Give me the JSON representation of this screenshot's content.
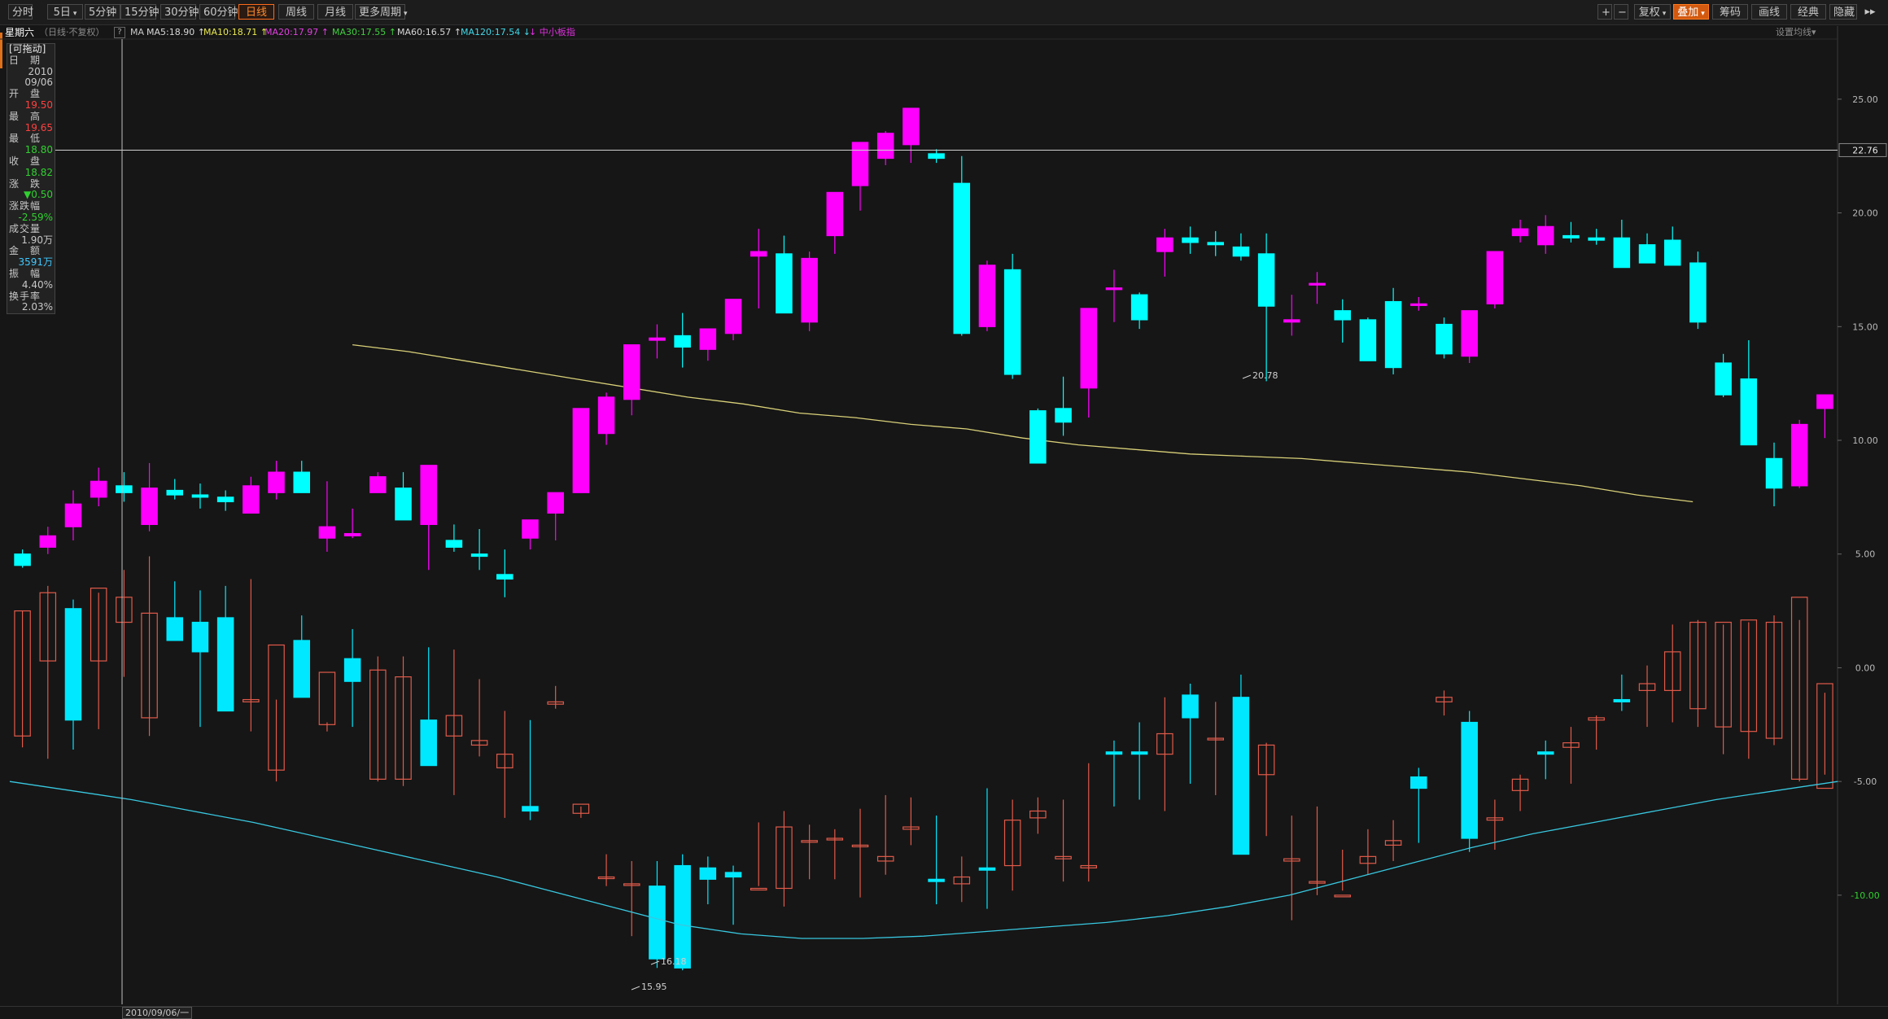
{
  "toolbar": {
    "left_buttons": [
      {
        "label": "分时",
        "active": false,
        "caret": false
      },
      {
        "label": "5日",
        "active": false,
        "caret": true
      },
      {
        "label": "5分钟",
        "active": false,
        "caret": false
      },
      {
        "label": "15分钟",
        "active": false,
        "caret": false
      },
      {
        "label": "30分钟",
        "active": false,
        "caret": false
      },
      {
        "label": "60分钟",
        "active": false,
        "caret": false
      },
      {
        "label": "日线",
        "active": true,
        "caret": false
      },
      {
        "label": "周线",
        "active": false,
        "caret": false
      },
      {
        "label": "月线",
        "active": false,
        "caret": false
      },
      {
        "label": "更多周期",
        "active": false,
        "caret": true
      }
    ],
    "zoom_in": "+",
    "zoom_out": "−",
    "right_buttons": [
      {
        "label": "复权",
        "caret": true,
        "hot": false
      },
      {
        "label": "叠加",
        "caret": true,
        "hot": true
      },
      {
        "label": "筹码",
        "caret": false,
        "hot": false
      },
      {
        "label": "画线",
        "caret": false,
        "hot": false
      },
      {
        "label": "经典",
        "caret": false,
        "hot": false
      },
      {
        "label": "隐藏",
        "caret": false,
        "hot": false
      }
    ],
    "hide_arrows": "▸▸"
  },
  "indicator_bar": {
    "title": "星期六",
    "subtitle": "（日线·不复权）",
    "help": "?",
    "ma_label": "MA",
    "items": [
      {
        "text": "MA5:18.90",
        "arrow": "↑",
        "color": "#d8d8d8"
      },
      {
        "text": "MA10:18.71",
        "arrow": "↑",
        "color": "#e8e850"
      },
      {
        "text": "MA20:17.97",
        "arrow": "↑",
        "color": "#e040e0"
      },
      {
        "text": "MA30:17.55",
        "arrow": "↑",
        "color": "#40d040"
      },
      {
        "text": "MA60:16.57",
        "arrow": "↑",
        "color": "#d8d8d8"
      },
      {
        "text": "MA120:17.54",
        "arrow": "↓",
        "color": "#40d8e8"
      },
      {
        "text": "中小板指",
        "arrow": "",
        "color": "#e030e0"
      }
    ],
    "settings": "设置均线",
    "settings_caret": "▾"
  },
  "info_panel": {
    "header": "[可拖动]",
    "rows": [
      {
        "label": "日　期",
        "values": [
          "2010",
          "09/06"
        ],
        "color": "#c8c8c8"
      },
      {
        "label": "开　盘",
        "values": [
          "19.50"
        ],
        "color": "#ff4040"
      },
      {
        "label": "最　高",
        "values": [
          "19.65"
        ],
        "color": "#ff4040"
      },
      {
        "label": "最　低",
        "values": [
          "18.80"
        ],
        "color": "#30d030"
      },
      {
        "label": "收　盘",
        "values": [
          "18.82"
        ],
        "color": "#30d030"
      },
      {
        "label": "涨　跌",
        "values": [
          "▼0.50"
        ],
        "color": "#30d030"
      },
      {
        "label": "涨跌幅",
        "values": [
          "-2.59%"
        ],
        "color": "#30d030"
      },
      {
        "label": "成交量",
        "values": [
          "1.90万"
        ],
        "color": "#c8c8c8"
      },
      {
        "label": "金　额",
        "values": [
          "3591万"
        ],
        "color": "#40c8ff"
      },
      {
        "label": "振　幅",
        "values": [
          "4.40%"
        ],
        "color": "#c8c8c8"
      },
      {
        "label": "换手率",
        "values": [
          "2.03%"
        ],
        "color": "#c8c8c8"
      }
    ]
  },
  "crosshair": {
    "price_tag": "22.76",
    "date_tag": "2010/09/06/一"
  },
  "annotations": {
    "high": "20.78",
    "low1": "16.18",
    "low2": "15.95"
  },
  "colors": {
    "up": "#ff00ff",
    "down": "#00ffff",
    "up_overlay": "#e05a4a",
    "down_overlay": "#00e8ff",
    "accent": "#ff6a1a"
  },
  "chart_data": {
    "type": "candlestick",
    "y_axis_ticks": [
      "25.00",
      "20.00",
      "15.00",
      "10.00",
      "5.00",
      "0.00",
      "-5.00",
      "-10.00"
    ],
    "y_tick_values": [
      25,
      20,
      15,
      10,
      5,
      0,
      -5,
      -10
    ],
    "ylim": [
      -14.8,
      27.5
    ],
    "main_series": {
      "name": "星期六",
      "candles": [
        [
          5.0,
          5.2,
          4.4,
          4.5
        ],
        [
          5.3,
          6.2,
          5.0,
          5.8
        ],
        [
          6.2,
          7.8,
          5.6,
          7.2
        ],
        [
          7.5,
          8.8,
          7.1,
          8.2
        ],
        [
          8.0,
          8.6,
          7.3,
          7.7
        ],
        [
          6.3,
          9.0,
          6.0,
          7.9
        ],
        [
          7.8,
          8.3,
          7.4,
          7.6
        ],
        [
          7.6,
          8.1,
          7.0,
          7.5
        ],
        [
          7.5,
          7.8,
          6.9,
          7.3
        ],
        [
          6.8,
          8.4,
          6.8,
          8.0
        ],
        [
          7.7,
          9.1,
          7.4,
          8.6
        ],
        [
          8.6,
          9.1,
          7.9,
          7.7
        ],
        [
          5.7,
          8.2,
          5.1,
          6.2
        ],
        [
          5.8,
          7.0,
          5.7,
          5.9
        ],
        [
          7.7,
          8.6,
          7.7,
          8.4
        ],
        [
          7.9,
          8.6,
          6.8,
          6.5
        ],
        [
          6.3,
          8.0,
          4.3,
          8.9
        ],
        [
          5.6,
          6.3,
          5.1,
          5.3
        ],
        [
          5.0,
          6.1,
          4.3,
          4.9
        ],
        [
          4.1,
          5.2,
          3.1,
          3.9
        ],
        [
          5.7,
          6.2,
          5.2,
          6.5
        ],
        [
          6.8,
          7.7,
          5.6,
          7.7
        ],
        [
          7.7,
          9.1,
          7.7,
          11.4
        ],
        [
          10.3,
          12.1,
          9.8,
          11.9
        ],
        [
          11.8,
          12.3,
          11.1,
          14.2
        ],
        [
          14.4,
          15.1,
          13.6,
          14.5
        ],
        [
          14.6,
          15.6,
          13.2,
          14.1
        ],
        [
          14.0,
          14.5,
          13.5,
          14.9
        ],
        [
          14.7,
          16.1,
          14.4,
          16.2
        ],
        [
          18.1,
          19.3,
          15.8,
          18.3
        ],
        [
          18.2,
          19.0,
          16.7,
          15.6
        ],
        [
          15.2,
          18.3,
          14.8,
          18.0
        ],
        [
          19.0,
          20.1,
          18.2,
          20.9
        ],
        [
          21.2,
          22.1,
          20.1,
          23.1
        ],
        [
          22.4,
          23.6,
          22.1,
          23.5
        ],
        [
          23.0,
          23.6,
          22.2,
          24.6
        ],
        [
          22.6,
          22.8,
          22.2,
          22.4
        ],
        [
          21.3,
          22.5,
          14.6,
          14.7
        ],
        [
          15.0,
          17.9,
          14.8,
          17.7
        ],
        [
          17.5,
          18.2,
          12.7,
          12.9
        ],
        [
          11.3,
          11.4,
          9.0,
          9.0
        ],
        [
          11.4,
          12.8,
          10.2,
          10.8
        ],
        [
          12.3,
          15.4,
          11.0,
          15.8
        ],
        [
          16.7,
          17.5,
          15.2,
          16.7
        ],
        [
          16.4,
          16.5,
          14.9,
          15.3
        ],
        [
          18.3,
          19.3,
          17.2,
          18.9
        ],
        [
          18.9,
          19.4,
          18.2,
          18.7
        ],
        [
          18.7,
          19.2,
          18.1,
          18.6
        ],
        [
          18.5,
          19.1,
          17.9,
          18.1
        ],
        [
          18.2,
          19.1,
          12.6,
          15.9
        ],
        [
          15.2,
          16.4,
          14.6,
          15.3
        ],
        [
          16.9,
          17.4,
          16.0,
          16.9
        ],
        [
          15.7,
          16.2,
          14.3,
          15.3
        ],
        [
          15.3,
          15.4,
          13.7,
          13.5
        ],
        [
          16.1,
          16.7,
          12.9,
          13.2
        ],
        [
          16.0,
          16.3,
          15.7,
          16.0
        ],
        [
          15.1,
          15.4,
          13.6,
          13.8
        ],
        [
          13.7,
          15.6,
          13.4,
          15.7
        ],
        [
          16.0,
          18.2,
          15.8,
          18.3
        ],
        [
          19.0,
          19.7,
          18.7,
          19.3
        ],
        [
          18.6,
          19.9,
          18.2,
          19.4
        ],
        [
          19.0,
          19.6,
          18.7,
          18.9
        ],
        [
          18.9,
          19.3,
          18.6,
          18.8
        ],
        [
          18.9,
          19.7,
          18.4,
          17.6
        ],
        [
          18.6,
          19.1,
          18.0,
          17.8
        ],
        [
          18.8,
          19.4,
          17.9,
          17.7
        ],
        [
          17.8,
          18.3,
          14.9,
          15.2
        ],
        [
          13.4,
          13.8,
          11.9,
          12.0
        ],
        [
          12.7,
          14.4,
          9.8,
          9.8
        ],
        [
          9.2,
          9.9,
          7.1,
          7.9
        ],
        [
          8.0,
          10.9,
          7.9,
          10.7
        ],
        [
          11.4,
          12.0,
          10.1,
          12.0
        ]
      ]
    },
    "overlay_series": {
      "name": "中小板指",
      "candles": [
        [
          -3.0,
          2.5,
          -3.5,
          2.5
        ],
        [
          0.3,
          3.6,
          -4.0,
          3.3
        ],
        [
          2.6,
          3.0,
          -3.6,
          -2.3
        ],
        [
          0.3,
          3.3,
          -2.7,
          3.5
        ],
        [
          2.0,
          4.3,
          -0.4,
          3.1
        ],
        [
          -2.2,
          4.9,
          -3.0,
          2.4
        ],
        [
          2.2,
          3.8,
          1.3,
          1.2
        ],
        [
          2.0,
          3.4,
          -2.6,
          0.7
        ],
        [
          2.2,
          3.6,
          -1.0,
          -1.9
        ],
        [
          -1.5,
          3.9,
          -2.8,
          -1.4
        ],
        [
          -4.5,
          -1.4,
          -5.0,
          1.0
        ],
        [
          1.2,
          2.3,
          -1.2,
          -1.3
        ],
        [
          -2.5,
          -2.4,
          -2.8,
          -0.2
        ],
        [
          0.4,
          1.7,
          -2.6,
          -0.6
        ],
        [
          -4.9,
          0.5,
          -5.0,
          -0.1
        ],
        [
          -4.9,
          0.5,
          -5.2,
          -0.4
        ],
        [
          -2.3,
          0.9,
          -3.5,
          -4.3
        ],
        [
          -3.0,
          0.8,
          -5.6,
          -2.1
        ],
        [
          -3.4,
          -0.5,
          -3.9,
          -3.2
        ],
        [
          -4.4,
          -1.9,
          -6.6,
          -3.8
        ],
        [
          -6.1,
          -2.3,
          -6.7,
          -6.3
        ],
        [
          -1.6,
          -0.8,
          -1.8,
          -1.5
        ],
        [
          -6.4,
          -6.1,
          -6.6,
          -6.0
        ],
        [
          -9.2,
          -8.2,
          -9.6,
          -9.2
        ],
        [
          -9.5,
          -8.5,
          -11.8,
          -9.5
        ],
        [
          -9.6,
          -8.5,
          -13.2,
          -12.8
        ],
        [
          -8.7,
          -8.2,
          -13.3,
          -13.2
        ],
        [
          -8.8,
          -8.3,
          -10.4,
          -9.3
        ],
        [
          -9.0,
          -8.7,
          -11.3,
          -9.2
        ],
        [
          -9.7,
          -6.8,
          -9.6,
          -9.7
        ],
        [
          -9.7,
          -6.3,
          -10.5,
          -7.0
        ],
        [
          -7.6,
          -6.9,
          -9.3,
          -7.6
        ],
        [
          -7.5,
          -7.1,
          -9.3,
          -7.5
        ],
        [
          -7.8,
          -6.2,
          -10.1,
          -7.8
        ],
        [
          -8.5,
          -5.6,
          -9.1,
          -8.3
        ],
        [
          -7.1,
          -5.7,
          -7.8,
          -7.0
        ],
        [
          -9.3,
          -6.5,
          -10.4,
          -9.4
        ],
        [
          -9.5,
          -8.3,
          -10.3,
          -9.2
        ],
        [
          -8.8,
          -5.3,
          -10.6,
          -8.9
        ],
        [
          -8.7,
          -5.8,
          -9.8,
          -6.7
        ],
        [
          -6.6,
          -5.7,
          -7.3,
          -6.3
        ],
        [
          -8.4,
          -5.8,
          -9.4,
          -8.3
        ],
        [
          -8.8,
          -4.2,
          -9.4,
          -8.7
        ],
        [
          -3.7,
          -3.2,
          -6.1,
          -3.8
        ],
        [
          -3.7,
          -2.4,
          -5.8,
          -3.8
        ],
        [
          -3.8,
          -1.3,
          -6.3,
          -2.9
        ],
        [
          -1.2,
          -0.7,
          -5.1,
          -2.2
        ],
        [
          -3.1,
          -1.5,
          -5.6,
          -3.1
        ],
        [
          -1.3,
          -0.3,
          -8.1,
          -8.2
        ],
        [
          -4.7,
          -3.3,
          -7.4,
          -3.4
        ],
        [
          -8.5,
          -6.5,
          -11.1,
          -8.4
        ],
        [
          -9.4,
          -6.1,
          -10.0,
          -9.4
        ],
        [
          -10.0,
          -8.0,
          -9.8,
          -10.0
        ],
        [
          -8.6,
          -7.1,
          -9.1,
          -8.3
        ],
        [
          -7.8,
          -6.7,
          -8.5,
          -7.6
        ],
        [
          -4.8,
          -4.4,
          -7.7,
          -5.3
        ],
        [
          -1.5,
          -1.0,
          -2.1,
          -1.3
        ],
        [
          -2.4,
          -1.9,
          -8.1,
          -7.5
        ],
        [
          -6.7,
          -5.8,
          -8.0,
          -6.6
        ],
        [
          -5.4,
          -4.7,
          -6.3,
          -4.9
        ],
        [
          -3.7,
          -3.2,
          -4.9,
          -3.8
        ],
        [
          -3.5,
          -2.6,
          -5.1,
          -3.3
        ],
        [
          -2.3,
          -2.1,
          -3.6,
          -2.2
        ],
        [
          -1.4,
          -0.3,
          -1.9,
          -1.5
        ],
        [
          -1.0,
          0.1,
          -2.6,
          -0.7
        ],
        [
          -1.0,
          1.9,
          -2.4,
          0.7
        ],
        [
          -1.8,
          2.1,
          -2.6,
          2.0
        ],
        [
          -2.6,
          1.9,
          -3.8,
          2.0
        ],
        [
          -2.8,
          2.0,
          -4.0,
          2.1
        ],
        [
          -3.1,
          2.3,
          -3.4,
          2.0
        ],
        [
          -4.9,
          2.1,
          -5.0,
          3.1
        ],
        [
          -5.3,
          -1.1,
          -4.7,
          -0.7
        ]
      ]
    },
    "moving_averages": {
      "ma120": {
        "label": "MA120",
        "values": [
          -5.0,
          -5.4,
          -5.8,
          -6.3,
          -6.8,
          -7.4,
          -8.0,
          -8.6,
          -9.2,
          -9.9,
          -10.6,
          -11.3,
          -11.7,
          -11.9,
          -11.9,
          -11.8,
          -11.6,
          -11.4,
          -11.2,
          -10.9,
          -10.5,
          -10.0,
          -9.3,
          -8.6,
          -7.9,
          -7.3,
          -6.8,
          -6.3,
          -5.8,
          -5.4,
          -5.0
        ]
      },
      "ma_yellow_overlay": {
        "label": "MA10",
        "values": [
          14.2,
          13.9,
          13.5,
          13.1,
          12.7,
          12.3,
          11.9,
          11.6,
          11.2,
          11.0,
          10.7,
          10.5,
          10.1,
          9.8,
          9.6,
          9.4,
          9.3,
          9.2,
          9.0,
          8.8,
          8.6,
          8.3,
          8.0,
          7.6,
          7.3
        ]
      }
    },
    "date_label": "2010/09/06/一"
  }
}
